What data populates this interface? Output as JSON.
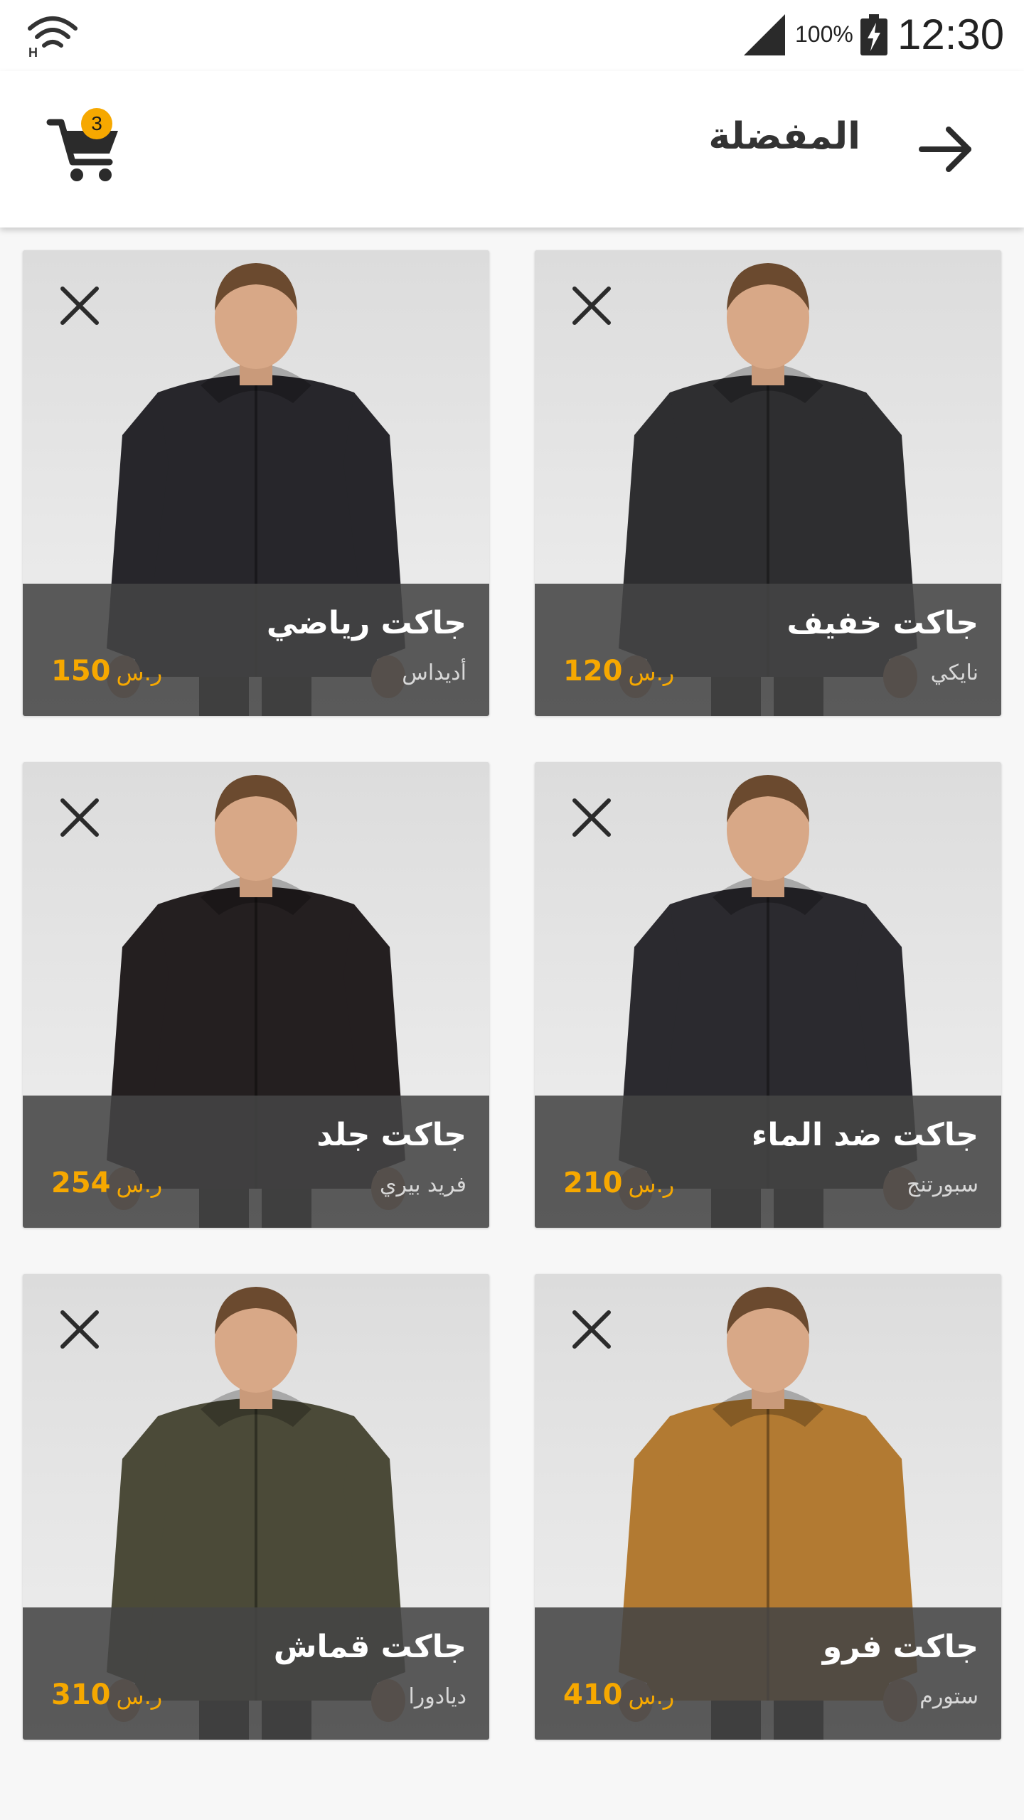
{
  "status_bar": {
    "battery": "100%",
    "time": "12:30",
    "icons": [
      "wifi-icon",
      "signal-icon",
      "battery-icon"
    ]
  },
  "header": {
    "title": "المفضلة",
    "back_icon": "arrow-right-icon",
    "cart_icon": "cart-icon",
    "cart_count": "3"
  },
  "colors": {
    "accent": "#f6a800",
    "overlay": "#444444",
    "card_bg": "#e6e6e6"
  },
  "products": [
    {
      "name": "جاكت خفيف",
      "brand": "نايكي",
      "price": "120",
      "currency": "ر.س",
      "jacket_color": "#2e2e30"
    },
    {
      "name": "جاكت رياضي",
      "brand": "أديداس",
      "price": "150",
      "currency": "ر.س",
      "jacket_color": "#27262b"
    },
    {
      "name": "جاكت ضد الماء",
      "brand": "سبورتنج",
      "price": "210",
      "currency": "ر.س",
      "jacket_color": "#2b2a2f"
    },
    {
      "name": "جاكت جلد",
      "brand": "فريد بيري",
      "price": "254",
      "currency": "ر.س",
      "jacket_color": "#241f20"
    },
    {
      "name": "جاكت فرو",
      "brand": "ستورم",
      "price": "410",
      "currency": "ر.س",
      "jacket_color": "#b27a32"
    },
    {
      "name": "جاكت قماش",
      "brand": "ديادورا",
      "price": "310",
      "currency": "ر.س",
      "jacket_color": "#4b4a38"
    }
  ]
}
